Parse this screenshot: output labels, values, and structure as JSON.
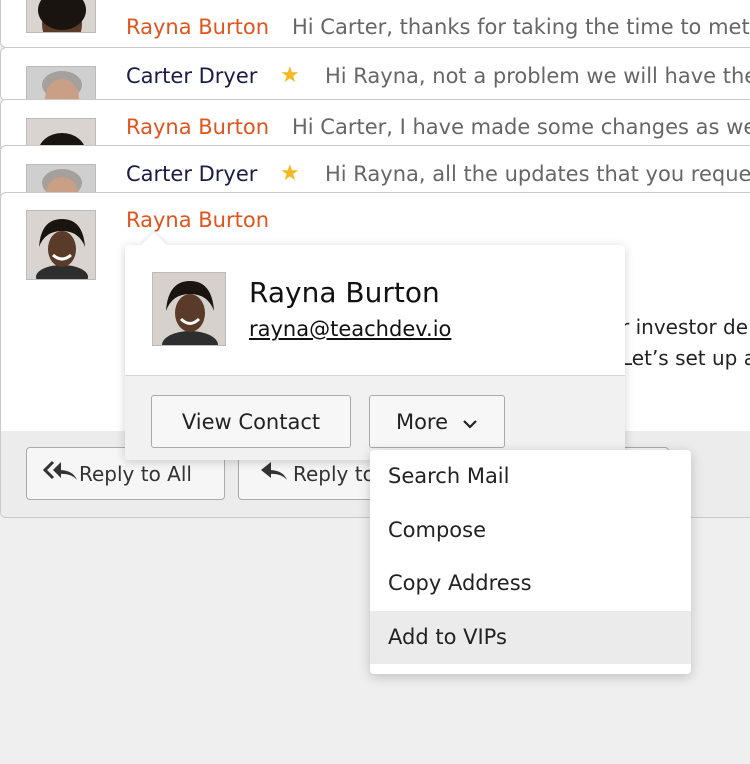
{
  "messages": [
    {
      "sender": "Rayna Burton",
      "snippet": "Hi Carter, thanks for taking the time to met w",
      "starred": false
    },
    {
      "sender": "Carter Dryer",
      "snippet": "Hi Rayna, not a problem we will have the",
      "starred": true
    },
    {
      "sender": "Rayna Burton",
      "snippet": "Hi Carter, I have made some changes as we",
      "starred": false
    },
    {
      "sender": "Carter Dryer",
      "snippet": "Hi Rayna, all the updates that you reques",
      "starred": true
    }
  ],
  "expanded": {
    "sender": "Rayna Burton",
    "body_line1": "r investor de",
    "body_line2": "Let’s set up a",
    "reply_all_label": "Reply to All",
    "reply_label": "Reply to"
  },
  "contact_card": {
    "name": "Rayna Burton",
    "email": "rayna@teachdev.io",
    "view_contact_label": "View Contact",
    "more_label": "More"
  },
  "more_menu": {
    "items": [
      "Search Mail",
      "Compose",
      "Copy Address",
      "Add to VIPs"
    ],
    "highlighted_index": 3
  },
  "colors": {
    "rayna_name": "#e0541e",
    "carter_name": "#1b1b45",
    "star": "#f6b820"
  }
}
